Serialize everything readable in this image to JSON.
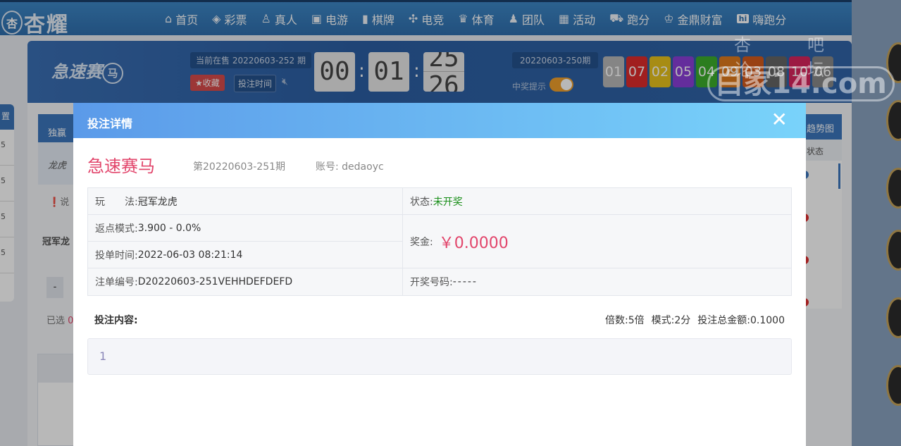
{
  "site": {
    "logo_text": "杏耀",
    "logo_badge": "杏"
  },
  "nav": [
    {
      "label": "首页",
      "icon": "home-icon",
      "glyph": "⌂"
    },
    {
      "label": "彩票",
      "icon": "ticket-icon",
      "glyph": "◈"
    },
    {
      "label": "真人",
      "icon": "person-icon",
      "glyph": "♙"
    },
    {
      "label": "电游",
      "icon": "slot-machine-icon",
      "glyph": "▣"
    },
    {
      "label": "棋牌",
      "icon": "cards-icon",
      "glyph": "▮"
    },
    {
      "label": "电竞",
      "icon": "gamepad-icon",
      "glyph": "✣"
    },
    {
      "label": "体育",
      "icon": "trophy-icon",
      "glyph": "♛"
    },
    {
      "label": "团队",
      "icon": "team-icon",
      "glyph": "♟"
    },
    {
      "label": "活动",
      "icon": "gift-icon",
      "glyph": "▦"
    },
    {
      "label": "跑分",
      "icon": "car-icon",
      "glyph": "⛟"
    },
    {
      "label": "金鼎财富",
      "icon": "crown-icon",
      "glyph": "♔"
    },
    {
      "label": "嗨跑分",
      "icon": "hi-icon",
      "glyph": "hi"
    }
  ],
  "game_header": {
    "logo": "急速赛",
    "logo_ring": "马",
    "current_issue": "当前在售 20220603-252 期",
    "favorite_label": "★收藏",
    "bet_time_label": "投注时间",
    "countdown": {
      "h": "00",
      "m": "01",
      "s_top": "25",
      "s_bottom": "26"
    },
    "prev_issue": "20220603-250期",
    "win_tip": "中奖提示",
    "result_numbers": [
      {
        "n": "01",
        "color": "#b9b9b9"
      },
      {
        "n": "07",
        "color": "#e02b2b"
      },
      {
        "n": "02",
        "color": "#e8c21c"
      },
      {
        "n": "05",
        "color": "#8b3fd8"
      },
      {
        "n": "04",
        "color": "#3cae2c"
      },
      {
        "n": "09",
        "color": "#e07a1c"
      },
      {
        "n": "03",
        "color": "#d45a1c"
      },
      {
        "n": "08",
        "color": "#666666"
      },
      {
        "n": "10",
        "color": "#d8255e"
      },
      {
        "n": "06",
        "color": "#8a8a8a"
      }
    ]
  },
  "background": {
    "left_head": "置",
    "left_values": [
      "5",
      "5",
      "5",
      "5"
    ],
    "tab_single": "独赢",
    "cell_longhu": "龙虎",
    "info": "说",
    "label_champion": "冠军龙",
    "minus": "-",
    "selected": "已选",
    "selected_count": "0",
    "right_tab": "趋势图",
    "right_head": "状态"
  },
  "watermark": {
    "top": "杏吧论坛",
    "main": "白家14.com"
  },
  "modal": {
    "title": "投注详情",
    "close": "✕",
    "game_name": "急速赛马",
    "issue": "第20220603-251期",
    "account_label": "账号:",
    "account": "dedaoyc",
    "play_label": "玩　　法:",
    "play_value": "冠军龙虎",
    "status_label": "状态:",
    "status_value": "未开奖",
    "rebate_label": "返点模式:",
    "rebate_value": "3.900 - 0.0%",
    "bet_time_label": "投单时间:",
    "bet_time_value": "2022-06-03 08:21:14",
    "prize_label": "奖金:",
    "prize_value": "￥0.0000",
    "order_label": "注单编号:",
    "order_value": "D20220603-251VEHHDEFDEFD",
    "draw_label": "开奖号码:",
    "draw_value": "-----",
    "content_label": "投注内容:",
    "multiple_label": "倍数:",
    "multiple_value": "5倍",
    "mode_label": "模式:",
    "mode_value": "2分",
    "total_label": "投注总金额:",
    "total_value": "0.1000",
    "bet_content": "1"
  }
}
